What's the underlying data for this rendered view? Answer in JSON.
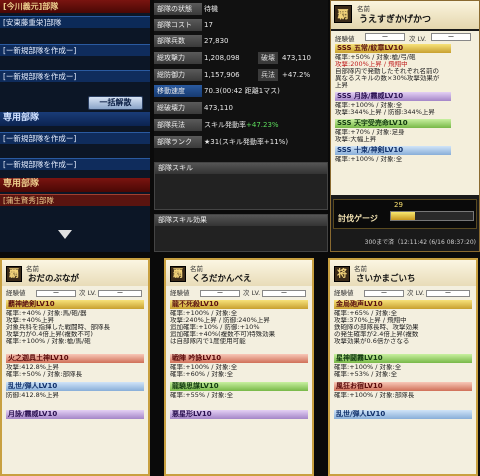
{
  "left": {
    "title1": "[今川義元]部隊",
    "slot1": "[安東藤重栄]部隊",
    "slot2": "[ー新規部隊を作成ー]",
    "slot3": "[ー新規部隊を作成ー]",
    "dissolve_button": "一括解散",
    "title2": "専用部隊",
    "slot4": "[ー新規部隊を作成ー]",
    "slot5": "[ー新規部隊を作成ー]",
    "title3": "専用部隊",
    "slot6": "[蒲生賢秀]部隊"
  },
  "info": {
    "rows": [
      {
        "label": "部隊の状態",
        "value": "待機"
      },
      {
        "label": "部隊コスト",
        "value": "17"
      },
      {
        "label": "部隊兵数",
        "value": "27,830"
      },
      {
        "label": "総攻撃力",
        "value": "1,208,098",
        "sub_label": "破壊",
        "sub_value": "473,110"
      },
      {
        "label": "総防御力",
        "value": "1,157,906",
        "sub_label": "兵法",
        "sub_value": "+47.2%"
      },
      {
        "label": "移動速度",
        "value": "70.3(00:42 距離1マス)"
      },
      {
        "label": "総破壊力",
        "value": "473,110"
      },
      {
        "label": "部隊兵法",
        "value": "スキル発動率",
        "value_green": "+47.23%"
      },
      {
        "label": "部隊ランク",
        "value": "★31(スキル発動率+11%)"
      }
    ],
    "skill_header": "部隊スキル",
    "skill_effect_header": "部隊スキル効果"
  },
  "bigcard": {
    "name_label": "名前",
    "name": "うえすぎかげかつ",
    "exp_label": "経験値",
    "exp_value": "ー",
    "next_lv": "次 LV.",
    "next_value": "ー",
    "skills": [
      {
        "rank": "SSS",
        "name": "五常/紋章LV10",
        "color": "gold"
      },
      {
        "rank": "SSS",
        "name": "月詠/霧威LV10",
        "color": "purple"
      },
      {
        "rank": "SSS",
        "name": "天宇受売命LV10",
        "color": "green"
      },
      {
        "rank": "SSS",
        "name": "十束/神剣LV10",
        "color": "blue"
      }
    ],
    "skill_texts": [
      "確率:+50% / 対象:槍/弓/砲",
      "攻撃:200%上昇 / 飛翔中",
      "自部隊内で発動したそれぞれ名前の",
      "異なるスキルの数×30%攻撃効果が",
      "上昇",
      "確率:+100% / 対象:全",
      "攻撃:344%上昇 / 防御:344%上昇",
      "確率:+70% / 対象:足身",
      "攻撃:大幅上昇",
      "確率:+100% / 対象:全"
    ],
    "gauge_label": "討伐ゲージ",
    "gauge_value": "29",
    "footer": "300まで済（12:11:42 (6/16 08:37:20)"
  },
  "cards": [
    {
      "avatar": "覇",
      "name": "おだのぶなが",
      "skills": [
        {
          "name": "覇神絶剣LV10",
          "color": "gold"
        },
        {
          "name": "火之迦具土神LV10",
          "color": "red"
        },
        {
          "name": "乱世/弾人LV10",
          "color": "blue"
        },
        {
          "name": "月詠/霧威LV10",
          "color": "purple"
        }
      ],
      "texts": [
        "確率:+40% / 対象:馬/砲/器",
        "攻撃:+40%上昇",
        "対象兵科を指揮した戦闘時、部隊長",
        "攻撃力が0.4倍上昇(複数不可)",
        "確率:+100% / 対象:槍/馬/砲",
        "攻撃:412.8%上昇",
        "確率:+50% / 対象:部隊長",
        "防御:412.8%上昇"
      ]
    },
    {
      "avatar": "覇",
      "name": "くろだかんべえ",
      "skills": [
        {
          "name": "龍不死殺LV10",
          "color": "gold"
        },
        {
          "name": "戦陣 吟詠LV10",
          "color": "red"
        },
        {
          "name": "龍驍思謀LV10",
          "color": "green"
        },
        {
          "name": "悪星形LV10",
          "color": "purple"
        }
      ],
      "texts": [
        "確率:+100% / 対象:全",
        "攻撃:240%上昇 / 防御:240%上昇",
        "追加確率:+10% / 防御:+10%",
        "追加確率:+40%(複数不可)特殊効果",
        "は自部隊内で1度使用可能",
        "確率:+100% / 対象:全",
        "確率:+60% / 対象:全",
        "確率:+55% / 対象:全"
      ]
    },
    {
      "avatar": "将",
      "name": "さいかまごいち",
      "skills": [
        {
          "name": "金烏砲声LV10",
          "color": "gold"
        },
        {
          "name": "星神闘霧LV10",
          "color": "green"
        },
        {
          "name": "風狂お宿LV10",
          "color": "red"
        },
        {
          "name": "乱世/弾人LV10",
          "color": "blue"
        }
      ],
      "texts": [
        "確率:+65% / 対象:全",
        "攻撃:370%上昇 / 飛翔中",
        "鉄砲隊の部隊長時、攻撃効果",
        "の発生確率が2.4倍上昇(複数",
        "攻撃効果が0.6倍かさなる",
        "確率:+100% / 対象:全",
        "確率:+53% / 対象:全",
        "確率:+100% / 対象:部隊長"
      ]
    }
  ],
  "card_common": {
    "name_label": "名前",
    "exp_label": "経験値",
    "exp_value": "ー",
    "next_label": "次 LV.",
    "next_value": "ー"
  }
}
